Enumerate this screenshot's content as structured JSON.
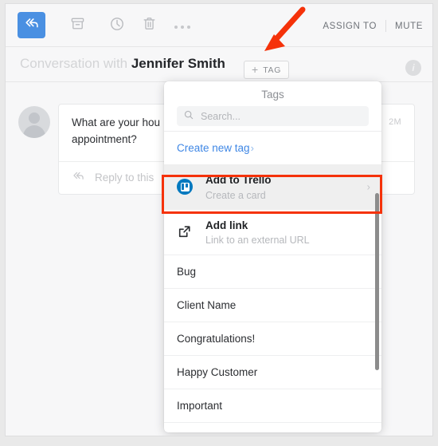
{
  "toolbar": {
    "reply_icon": "reply-all-icon",
    "archive_icon": "archive-icon",
    "snooze_icon": "clock-icon",
    "delete_icon": "trash-icon",
    "more_icon": "ellipsis-icon",
    "assign_to_label": "ASSIGN TO",
    "mute_label": "MUTE"
  },
  "conversation": {
    "prefix": "Conversation with ",
    "contact_name": "Jennifer Smith",
    "tag_button": {
      "plus": "+",
      "label": "TAG"
    },
    "info_icon": "info-icon",
    "info_letter": "i",
    "message": {
      "text": "What are your hou                appointment?",
      "line1": "What are your hou",
      "line2": "appointment?",
      "time": "2M",
      "reply_placeholder": "Reply to this",
      "reply_icon": "reply-all-icon",
      "avatar": "avatar-placeholder-icon"
    }
  },
  "tags_popup": {
    "title": "Tags",
    "search": {
      "placeholder": "Search...",
      "value": "",
      "icon": "search-icon"
    },
    "create_new_tag": {
      "label": "Create new tag",
      "chevron": "›"
    },
    "actions": [
      {
        "icon": "trello-icon",
        "title": "Add to Trello",
        "subtitle": "Create a card",
        "chevron": "›",
        "highlighted": true
      },
      {
        "icon": "external-link-icon",
        "title": "Add link",
        "subtitle": "Link to an external URL",
        "chevron": "",
        "highlighted": false
      }
    ],
    "tags": [
      "Bug",
      "Client Name",
      "Congratulations!",
      "Happy Customer",
      "Important"
    ]
  },
  "annotations": {
    "arrow_color": "#f5320a",
    "highlight_color": "#f5320a",
    "arrow_target": "tag-button"
  },
  "colors": {
    "accent_blue": "#4a90e2",
    "link_blue": "#3f87e5",
    "trello_blue": "#0079bf",
    "annotation_red": "#f5320a",
    "page_bg": "#e9e9e9",
    "app_bg": "#f7f7f8"
  }
}
